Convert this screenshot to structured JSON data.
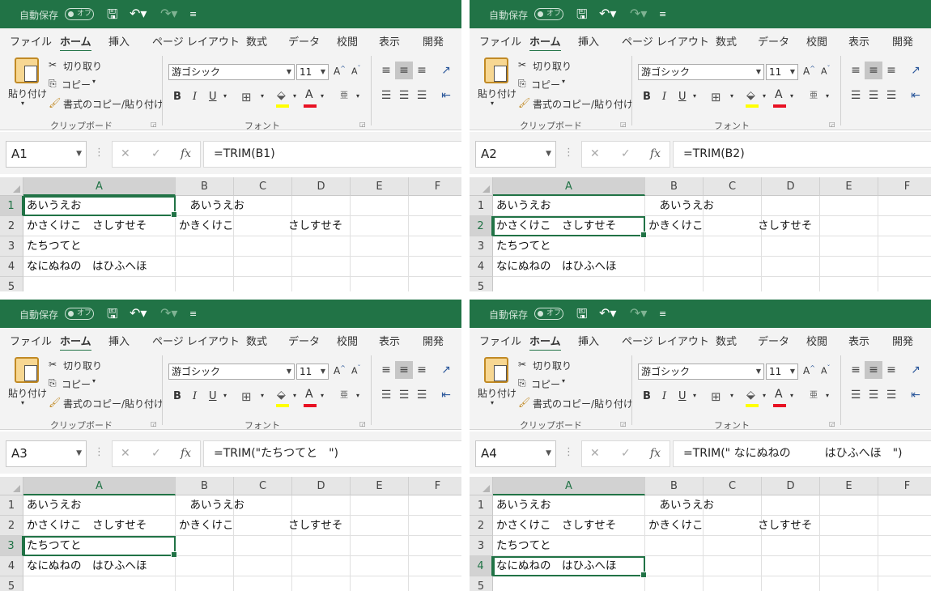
{
  "app": {
    "autosave_label": "自動保存",
    "autosave_toggle": "オフ",
    "colors": {
      "brand": "#217346",
      "ribbon_bg": "#f3f3f3",
      "font_color_red": "#e81123",
      "highlight_yellow": "#ffff00"
    },
    "qat_icons": [
      "save-icon",
      "undo-icon",
      "redo-icon",
      "customize-qat-icon"
    ]
  },
  "tabs": [
    "ファイル",
    "ホーム",
    "挿入",
    "ページ レイアウト",
    "数式",
    "データ",
    "校閲",
    "表示",
    "開発"
  ],
  "active_tab": "ホーム",
  "ribbon": {
    "paste": "貼り付け",
    "cut": "切り取り",
    "copy": "コピー",
    "format_painter": "書式のコピー/貼り付け",
    "clipboard_group": "クリップボード",
    "font_name": "游ゴシック",
    "font_size": "11",
    "bold": "B",
    "italic": "I",
    "underline": "U",
    "font_group": "フォント",
    "increase_font": "A^",
    "decrease_font": "Aˇ",
    "phonetic": "亜"
  },
  "formula_bar": {
    "fx": "fx",
    "cancel": "✕",
    "enter": "✓"
  },
  "grid": {
    "columns": [
      "A",
      "B",
      "C",
      "D",
      "E",
      "F"
    ],
    "rows": [
      "1",
      "2",
      "3",
      "4",
      "5"
    ],
    "cells": {
      "A1": "あいうえお",
      "B1": "　あいうえお",
      "A2": "かさくけこ　さしすせそ",
      "B2": "かきくけこ　　　　　さしすせそ",
      "A3": "たちつてと",
      "A4": "なにぬねの　はひふへほ"
    }
  },
  "panels": [
    {
      "name_box": "A1",
      "formula": "=TRIM(B1)",
      "active_row": 1
    },
    {
      "name_box": "A2",
      "formula": "=TRIM(B2)",
      "active_row": 2
    },
    {
      "name_box": "A3",
      "formula": "=TRIM(\"たちつてと　\")",
      "active_row": 3
    },
    {
      "name_box": "A4",
      "formula": "=TRIM(\" なにぬねの　　　はひふへほ　\")",
      "active_row": 4
    }
  ]
}
